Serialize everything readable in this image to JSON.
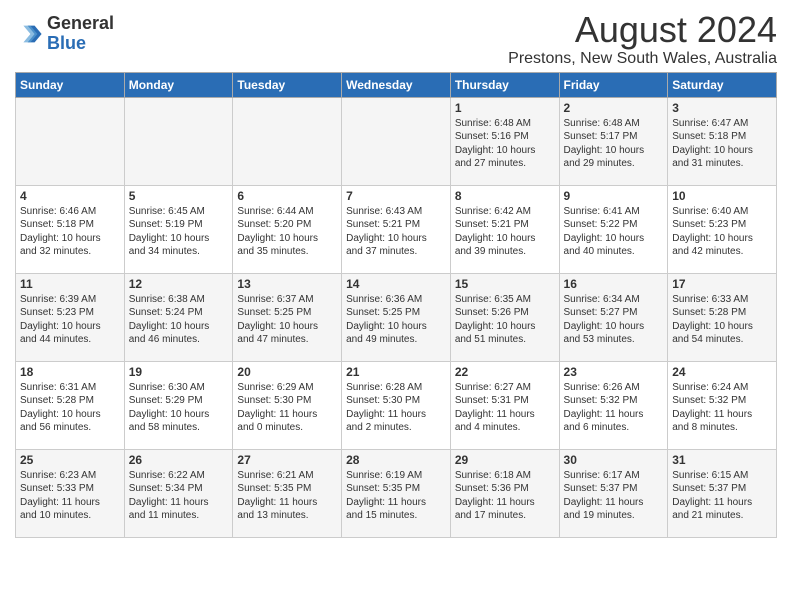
{
  "logo": {
    "general": "General",
    "blue": "Blue"
  },
  "title": "August 2024",
  "subtitle": "Prestons, New South Wales, Australia",
  "days_header": [
    "Sunday",
    "Monday",
    "Tuesday",
    "Wednesday",
    "Thursday",
    "Friday",
    "Saturday"
  ],
  "weeks": [
    [
      {
        "day": "",
        "info": ""
      },
      {
        "day": "",
        "info": ""
      },
      {
        "day": "",
        "info": ""
      },
      {
        "day": "",
        "info": ""
      },
      {
        "day": "1",
        "info": "Sunrise: 6:48 AM\nSunset: 5:16 PM\nDaylight: 10 hours\nand 27 minutes."
      },
      {
        "day": "2",
        "info": "Sunrise: 6:48 AM\nSunset: 5:17 PM\nDaylight: 10 hours\nand 29 minutes."
      },
      {
        "day": "3",
        "info": "Sunrise: 6:47 AM\nSunset: 5:18 PM\nDaylight: 10 hours\nand 31 minutes."
      }
    ],
    [
      {
        "day": "4",
        "info": "Sunrise: 6:46 AM\nSunset: 5:18 PM\nDaylight: 10 hours\nand 32 minutes."
      },
      {
        "day": "5",
        "info": "Sunrise: 6:45 AM\nSunset: 5:19 PM\nDaylight: 10 hours\nand 34 minutes."
      },
      {
        "day": "6",
        "info": "Sunrise: 6:44 AM\nSunset: 5:20 PM\nDaylight: 10 hours\nand 35 minutes."
      },
      {
        "day": "7",
        "info": "Sunrise: 6:43 AM\nSunset: 5:21 PM\nDaylight: 10 hours\nand 37 minutes."
      },
      {
        "day": "8",
        "info": "Sunrise: 6:42 AM\nSunset: 5:21 PM\nDaylight: 10 hours\nand 39 minutes."
      },
      {
        "day": "9",
        "info": "Sunrise: 6:41 AM\nSunset: 5:22 PM\nDaylight: 10 hours\nand 40 minutes."
      },
      {
        "day": "10",
        "info": "Sunrise: 6:40 AM\nSunset: 5:23 PM\nDaylight: 10 hours\nand 42 minutes."
      }
    ],
    [
      {
        "day": "11",
        "info": "Sunrise: 6:39 AM\nSunset: 5:23 PM\nDaylight: 10 hours\nand 44 minutes."
      },
      {
        "day": "12",
        "info": "Sunrise: 6:38 AM\nSunset: 5:24 PM\nDaylight: 10 hours\nand 46 minutes."
      },
      {
        "day": "13",
        "info": "Sunrise: 6:37 AM\nSunset: 5:25 PM\nDaylight: 10 hours\nand 47 minutes."
      },
      {
        "day": "14",
        "info": "Sunrise: 6:36 AM\nSunset: 5:25 PM\nDaylight: 10 hours\nand 49 minutes."
      },
      {
        "day": "15",
        "info": "Sunrise: 6:35 AM\nSunset: 5:26 PM\nDaylight: 10 hours\nand 51 minutes."
      },
      {
        "day": "16",
        "info": "Sunrise: 6:34 AM\nSunset: 5:27 PM\nDaylight: 10 hours\nand 53 minutes."
      },
      {
        "day": "17",
        "info": "Sunrise: 6:33 AM\nSunset: 5:28 PM\nDaylight: 10 hours\nand 54 minutes."
      }
    ],
    [
      {
        "day": "18",
        "info": "Sunrise: 6:31 AM\nSunset: 5:28 PM\nDaylight: 10 hours\nand 56 minutes."
      },
      {
        "day": "19",
        "info": "Sunrise: 6:30 AM\nSunset: 5:29 PM\nDaylight: 10 hours\nand 58 minutes."
      },
      {
        "day": "20",
        "info": "Sunrise: 6:29 AM\nSunset: 5:30 PM\nDaylight: 11 hours\nand 0 minutes."
      },
      {
        "day": "21",
        "info": "Sunrise: 6:28 AM\nSunset: 5:30 PM\nDaylight: 11 hours\nand 2 minutes."
      },
      {
        "day": "22",
        "info": "Sunrise: 6:27 AM\nSunset: 5:31 PM\nDaylight: 11 hours\nand 4 minutes."
      },
      {
        "day": "23",
        "info": "Sunrise: 6:26 AM\nSunset: 5:32 PM\nDaylight: 11 hours\nand 6 minutes."
      },
      {
        "day": "24",
        "info": "Sunrise: 6:24 AM\nSunset: 5:32 PM\nDaylight: 11 hours\nand 8 minutes."
      }
    ],
    [
      {
        "day": "25",
        "info": "Sunrise: 6:23 AM\nSunset: 5:33 PM\nDaylight: 11 hours\nand 10 minutes."
      },
      {
        "day": "26",
        "info": "Sunrise: 6:22 AM\nSunset: 5:34 PM\nDaylight: 11 hours\nand 11 minutes."
      },
      {
        "day": "27",
        "info": "Sunrise: 6:21 AM\nSunset: 5:35 PM\nDaylight: 11 hours\nand 13 minutes."
      },
      {
        "day": "28",
        "info": "Sunrise: 6:19 AM\nSunset: 5:35 PM\nDaylight: 11 hours\nand 15 minutes."
      },
      {
        "day": "29",
        "info": "Sunrise: 6:18 AM\nSunset: 5:36 PM\nDaylight: 11 hours\nand 17 minutes."
      },
      {
        "day": "30",
        "info": "Sunrise: 6:17 AM\nSunset: 5:37 PM\nDaylight: 11 hours\nand 19 minutes."
      },
      {
        "day": "31",
        "info": "Sunrise: 6:15 AM\nSunset: 5:37 PM\nDaylight: 11 hours\nand 21 minutes."
      }
    ]
  ]
}
